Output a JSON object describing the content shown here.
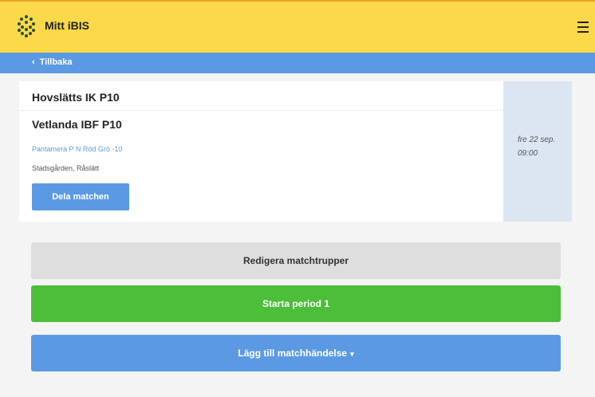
{
  "header": {
    "app_title": "Mitt iBIS",
    "logo_icon": "ibis-logo",
    "menu_icon": "hamburger-menu-icon",
    "colors": {
      "background": "#fcd94a",
      "accent_line": "#e9a227"
    }
  },
  "nav": {
    "back_chevron": "‹",
    "back_label": "Tillbaka",
    "color": "#5b9ae2"
  },
  "match": {
    "home_team": "Hovslätts IK P10",
    "away_team": "Vetlanda IBF P10",
    "series": "Pantamera P N Röd Grö -10",
    "venue": "Stadsgården, Råslätt",
    "share_label": "Dela matchen",
    "date": "fre 22 sep.",
    "time": "09:00"
  },
  "actions": {
    "edit_squads_label": "Redigera matchtrupper",
    "start_period_label": "Starta period 1",
    "add_event_label": "Lägg till matchhändelse",
    "add_event_caret": "▾",
    "colors": {
      "edit": "#dedede",
      "start": "#4cbe3a",
      "add": "#5b9ae2"
    }
  }
}
